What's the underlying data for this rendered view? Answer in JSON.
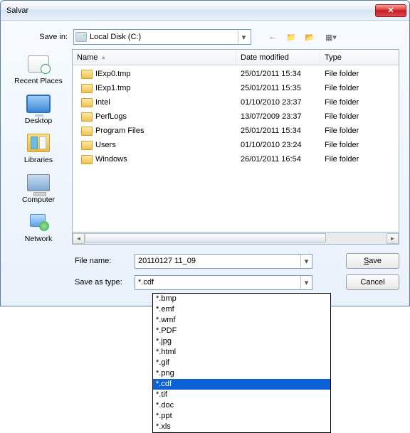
{
  "window": {
    "title": "Salvar"
  },
  "labels": {
    "save_in": "Save in:",
    "file_name": "File name:",
    "save_as_type": "Save as type:"
  },
  "save_in_combo": {
    "text": "Local Disk (C:)"
  },
  "columns": {
    "name": "Name",
    "date": "Date modified",
    "type": "Type"
  },
  "places": {
    "recent": "Recent Places",
    "desktop": "Desktop",
    "libraries": "Libraries",
    "computer": "Computer",
    "network": "Network"
  },
  "files": [
    {
      "name": "IExp0.tmp",
      "date": "25/01/2011 15:34",
      "type": "File folder"
    },
    {
      "name": "IExp1.tmp",
      "date": "25/01/2011 15:35",
      "type": "File folder"
    },
    {
      "name": "Intel",
      "date": "01/10/2010 23:37",
      "type": "File folder"
    },
    {
      "name": "PerfLogs",
      "date": "13/07/2009 23:37",
      "type": "File folder"
    },
    {
      "name": "Program Files",
      "date": "25/01/2011 15:34",
      "type": "File folder"
    },
    {
      "name": "Users",
      "date": "01/10/2010 23:24",
      "type": "File folder"
    },
    {
      "name": "Windows",
      "date": "26/01/2011 16:54",
      "type": "File folder"
    }
  ],
  "file_name_value": "20110127 11_09",
  "save_as_type_value": "*.cdf",
  "buttons": {
    "save": "Save",
    "cancel": "Cancel"
  },
  "type_options": [
    "*.bmp",
    "*.emf",
    "*.wmf",
    "*.PDF",
    "*.jpg",
    "*.html",
    "*.gif",
    "*.png",
    "*.cdf",
    "*.tif",
    "*.doc",
    "*.ppt",
    "*.xls"
  ],
  "type_selected_index": 8
}
